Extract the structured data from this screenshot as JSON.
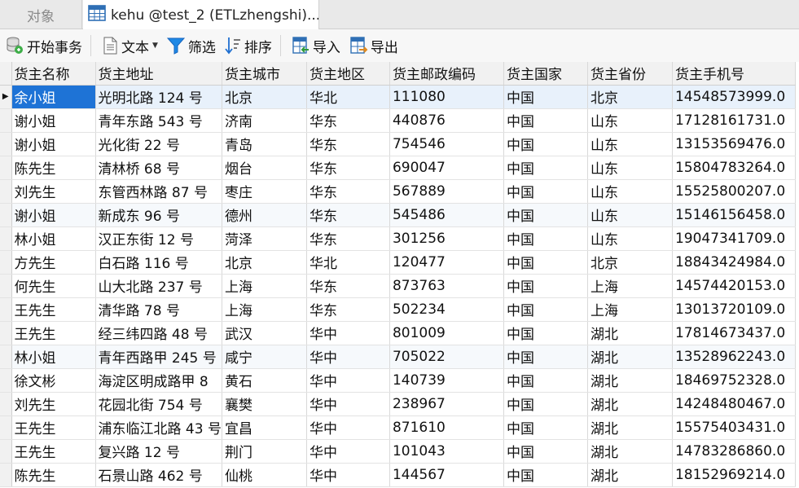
{
  "tabs": {
    "objects_label": "对象",
    "active_label": "kehu @test_2 (ETLzhengshi)..."
  },
  "toolbar": {
    "begin_transaction": "开始事务",
    "text": "文本",
    "filter": "筛选",
    "sort": "排序",
    "import": "导入",
    "export": "导出"
  },
  "grid": {
    "columns": [
      "货主名称",
      "货主地址",
      "货主城市",
      "货主地区",
      "货主邮政编码",
      "货主国家",
      "货主省份",
      "货主手机号"
    ],
    "rows": [
      [
        "余小姐",
        "光明北路 124 号",
        "北京",
        "华北",
        "111080",
        "中国",
        "北京",
        "14548573999.0"
      ],
      [
        "谢小姐",
        "青年东路 543 号",
        "济南",
        "华东",
        "440876",
        "中国",
        "山东",
        "17128161731.0"
      ],
      [
        "谢小姐",
        "光化街 22 号",
        "青岛",
        "华东",
        "754546",
        "中国",
        "山东",
        "13153569476.0"
      ],
      [
        "陈先生",
        "清林桥 68 号",
        "烟台",
        "华东",
        "690047",
        "中国",
        "山东",
        "15804783264.0"
      ],
      [
        "刘先生",
        "东管西林路 87 号",
        "枣庄",
        "华东",
        "567889",
        "中国",
        "山东",
        "15525800207.0"
      ],
      [
        "谢小姐",
        "新成东 96 号",
        "德州",
        "华东",
        "545486",
        "中国",
        "山东",
        "15146156458.0"
      ],
      [
        "林小姐",
        "汉正东街 12 号",
        "菏泽",
        "华东",
        "301256",
        "中国",
        "山东",
        "19047341709.0"
      ],
      [
        "方先生",
        "白石路 116 号",
        "北京",
        "华北",
        "120477",
        "中国",
        "北京",
        "18843424984.0"
      ],
      [
        "何先生",
        "山大北路 237 号",
        "上海",
        "华东",
        "873763",
        "中国",
        "上海",
        "14574420153.0"
      ],
      [
        "王先生",
        "清华路 78 号",
        "上海",
        "华东",
        "502234",
        "中国",
        "上海",
        "13013720109.0"
      ],
      [
        "王先生",
        "经三纬四路 48 号",
        "武汉",
        "华中",
        "801009",
        "中国",
        "湖北",
        "17814673437.0"
      ],
      [
        "林小姐",
        "青年西路甲 245 号",
        "咸宁",
        "华中",
        "705022",
        "中国",
        "湖北",
        "13528962243.0"
      ],
      [
        "徐文彬",
        "海淀区明成路甲 8",
        "黄石",
        "华中",
        "140739",
        "中国",
        "湖北",
        "18469752328.0"
      ],
      [
        "刘先生",
        "花园北街 754 号",
        "襄樊",
        "华中",
        "238967",
        "中国",
        "湖北",
        "14248480467.0"
      ],
      [
        "王先生",
        "浦东临江北路 43 号",
        "宜昌",
        "华中",
        "871610",
        "中国",
        "湖北",
        "15575403431.0"
      ],
      [
        "王先生",
        "复兴路 12 号",
        "荆门",
        "华中",
        "101043",
        "中国",
        "湖北",
        "14783286860.0"
      ],
      [
        "陈先生",
        "石景山路 462 号",
        "仙桃",
        "华中",
        "144567",
        "中国",
        "湖北",
        "18152969214.0"
      ]
    ],
    "current_row_marker": "▶"
  },
  "colors": {
    "selection": "#1e73d6",
    "header_bg": "#f1f1f1",
    "filter_icon": "#1e88e5"
  }
}
